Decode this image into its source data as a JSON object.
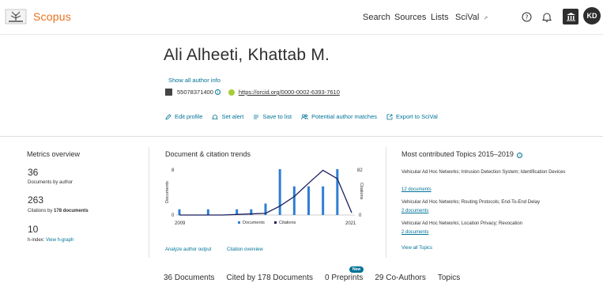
{
  "header": {
    "brand": "Scopus",
    "nav": [
      "Search",
      "Sources",
      "Lists",
      "SciVal"
    ],
    "scival_arrow": "↗",
    "avatar_initials": "KD"
  },
  "author": {
    "name": "Ali Alheeti, Khattab M.",
    "show_info": "Show all author info",
    "scopus_id": "55078371400",
    "orcid": "https://orcid.org/0000-0002-6393-7610"
  },
  "actions": [
    "Edit profile",
    "Set alert",
    "Save to list",
    "Potential author matches",
    "Export to SciVal"
  ],
  "metrics": {
    "title": "Metrics overview",
    "documents_value": "36",
    "documents_label": "Documents by author",
    "citations_value": "263",
    "citations_label_prefix": "Citations by",
    "citations_label_bold": "178 documents",
    "hindex_value": "10",
    "hindex_label": "h-index:",
    "hindex_link": "View h-graph"
  },
  "trends": {
    "title": "Document & citation trends",
    "analyze_link": "Analyze author output",
    "citation_link": "Citation overview"
  },
  "chart_data": {
    "type": "bar",
    "x_start_label": "2009",
    "x_end_label": "2021",
    "left_axis_label": "Documents",
    "right_axis_label": "Citations",
    "left_ticks": [
      "8",
      "0"
    ],
    "right_ticks": [
      "82",
      "0"
    ],
    "ylim_documents": [
      0,
      8
    ],
    "ylim_citations": [
      0,
      82
    ],
    "legend": [
      "Documents",
      "Citations"
    ],
    "years": [
      2009,
      2010,
      2011,
      2012,
      2013,
      2014,
      2015,
      2016,
      2017,
      2018,
      2019,
      2020,
      2021
    ],
    "documents": [
      1,
      0,
      1,
      0,
      1,
      1,
      2,
      8,
      5,
      5,
      5,
      8,
      0
    ],
    "citations": [
      0,
      0,
      0,
      0,
      1,
      2,
      3,
      16,
      33,
      57,
      80,
      65,
      4
    ],
    "colors": {
      "documents": "#2e7fd4",
      "citations": "#1a1f5e"
    }
  },
  "topics": {
    "title": "Most contributed Topics 2015–2019",
    "items": [
      {
        "name": "Vehicular Ad Hoc Networks; Intrusion Detection System; Identification Devices",
        "docs": "12 documents"
      },
      {
        "name": "Vehicular Ad Hoc Networks; Routing Protocols; End-To-End Delay",
        "docs": "2 documents"
      },
      {
        "name": "Vehicular Ad Hoc Networks; Location Privacy; Revocation",
        "docs": "2 documents"
      }
    ],
    "view_all": "View all Topics"
  },
  "tabs": [
    "36 Documents",
    "Cited by 178 Documents",
    "0 Preprints",
    "29 Co-Authors",
    "Topics"
  ],
  "new_badge": "New",
  "accent": "#e9711c",
  "link_color": "#007398"
}
